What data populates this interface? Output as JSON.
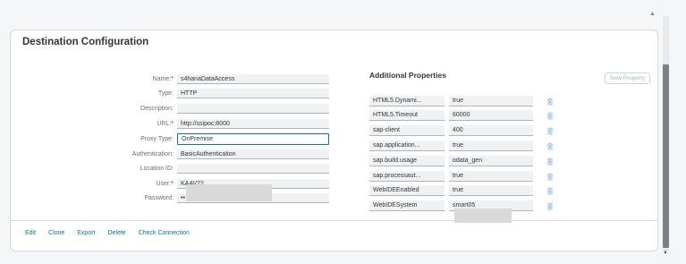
{
  "card_title": "Destination Configuration",
  "fields": [
    {
      "label": "Name:",
      "required": true,
      "value": "s4hanaDataAccess"
    },
    {
      "label": "Type:",
      "required": false,
      "value": "HTTP"
    },
    {
      "label": "Description:",
      "required": false,
      "value": ""
    },
    {
      "label": "URL:",
      "required": true,
      "value": "http://ssipoc:8000"
    },
    {
      "label": "Proxy Type:",
      "required": false,
      "value": "OnPremise"
    },
    {
      "label": "Authentication:",
      "required": false,
      "value": "BasicAuthentication"
    },
    {
      "label": "Location ID:",
      "required": false,
      "value": ""
    },
    {
      "label": "User:",
      "required": true,
      "value": "KAAV22"
    },
    {
      "label": "Password:",
      "required": false,
      "value": "••"
    }
  ],
  "additional_properties": {
    "title": "Additional Properties",
    "new_button": "New Property",
    "items": [
      {
        "name": "HTML5.Dynami...",
        "value": "true"
      },
      {
        "name": "HTML5.Timeout",
        "value": "60000"
      },
      {
        "name": "sap-client",
        "value": "400"
      },
      {
        "name": "sap.application...",
        "value": "true"
      },
      {
        "name": "sap.build.usage",
        "value": "odata_gen"
      },
      {
        "name": "sap.processaut...",
        "value": "true"
      },
      {
        "name": "WebIDEEnabled",
        "value": "true"
      },
      {
        "name": "WebIDESystem",
        "value": "smart05"
      }
    ]
  },
  "actions": [
    "Edit",
    "Clone",
    "Export",
    "Delete",
    "Check Connection"
  ],
  "required_marker": "*",
  "colors": {
    "link": "#0a6ed1",
    "required": "#bb0000",
    "focus": "#0a6ed1"
  }
}
